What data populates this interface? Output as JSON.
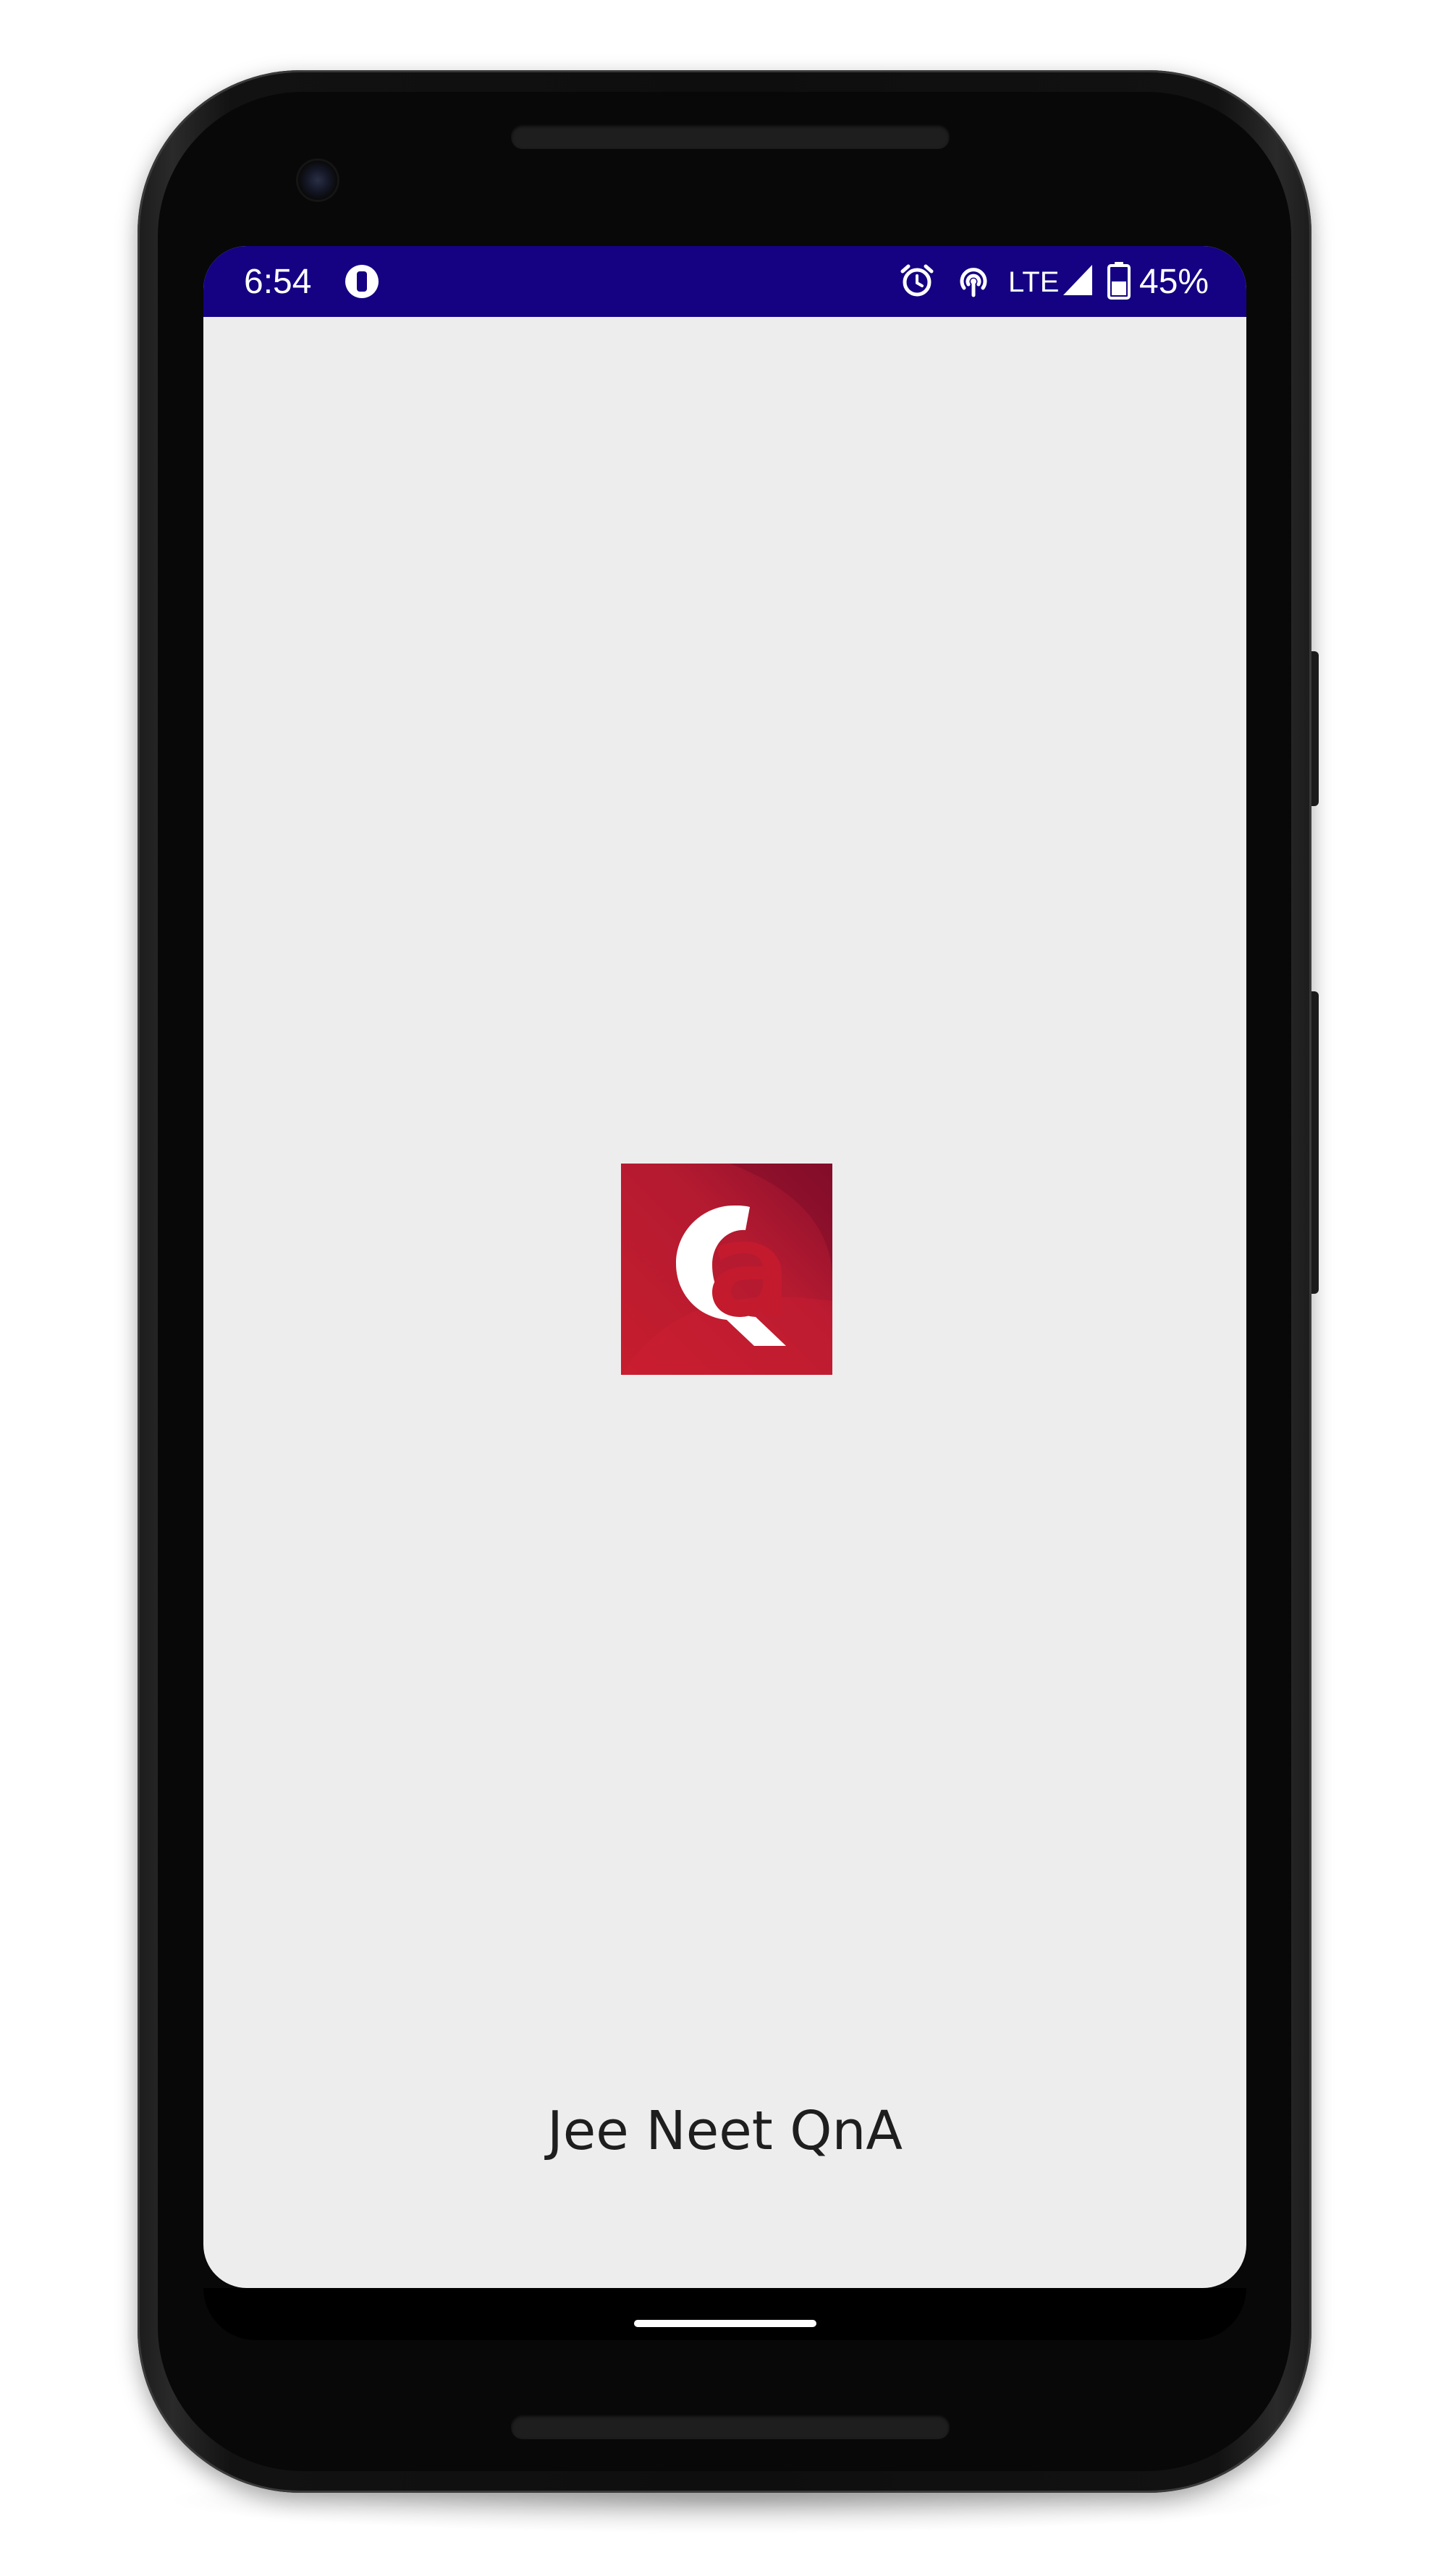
{
  "status_bar": {
    "time": "6:54",
    "network_label": "LTE",
    "battery_percent": "45%",
    "icons": [
      "app-notification-icon",
      "alarm-icon",
      "hotspot-icon",
      "signal-icon",
      "battery-icon"
    ],
    "background_color": "#140282"
  },
  "splash": {
    "app_name": "Jee Neet QnA",
    "logo_icon": "qa-logo-icon",
    "logo_color": "#c41a2e",
    "background_color": "#eeedee"
  },
  "navigation": {
    "home_indicator": "home-pill"
  }
}
